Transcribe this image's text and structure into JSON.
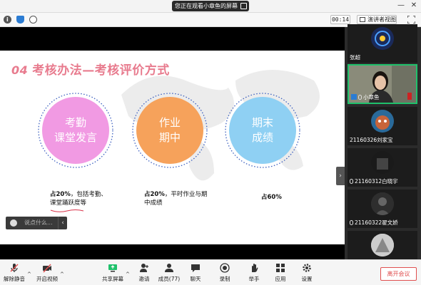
{
  "window": {
    "title": "您正在观看小章鱼的屏幕",
    "minimize_icon": "minimize-icon",
    "close_icon": "close-icon"
  },
  "toolbar": {
    "timer": "00:14",
    "view_mode": "演讲者视图"
  },
  "slide": {
    "number": "04",
    "heading": "考核办法—考核评价方式",
    "circles": [
      {
        "lines": [
          "考勤",
          "课堂发言"
        ],
        "color": "#f19ae3"
      },
      {
        "lines": [
          "作业",
          "期中"
        ],
        "color": "#f6a25b"
      },
      {
        "lines": [
          "期末",
          "成绩"
        ],
        "color": "#8fd0f3"
      }
    ],
    "captions": [
      {
        "bold": "占20%",
        "rest": "，包括考勤、课堂踊跃度等"
      },
      {
        "bold": "占20%",
        "rest": "，平时作业与期中成绩"
      },
      {
        "bold": "占60%",
        "rest": ""
      }
    ]
  },
  "chat": {
    "placeholder": "说点什么..."
  },
  "participants": [
    {
      "name": "张超",
      "active": false,
      "mic": false
    },
    {
      "name": "小章鱼",
      "active": true,
      "mic": true
    },
    {
      "name": "21160326刘家宝",
      "active": false,
      "mic": false
    },
    {
      "name": "21160312白晓宇",
      "active": false,
      "mic": true
    },
    {
      "name": "21160322翟文娇",
      "active": false,
      "mic": true
    },
    {
      "name": "",
      "active": false,
      "mic": false
    }
  ],
  "bottombar": {
    "unmute": "解除静音",
    "video": "开启视频",
    "share": "共享屏幕",
    "invite": "邀请",
    "members": "成员(77)",
    "chat": "聊天",
    "record": "录制",
    "raise_hand": "举手",
    "apps": "应用",
    "settings": "设置",
    "leave": "离开会议"
  },
  "colors": {
    "accent_green": "#1fc16b",
    "leave_red": "#e04f4f",
    "heading_pink": "#e87b8e"
  }
}
